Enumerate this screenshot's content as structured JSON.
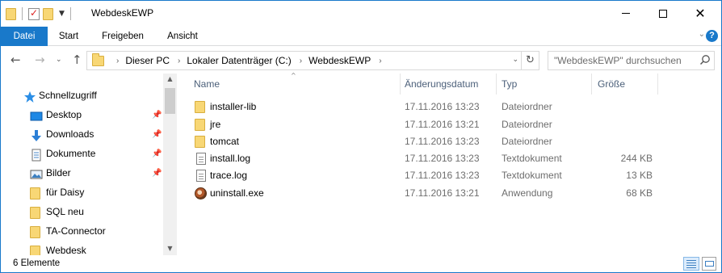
{
  "window": {
    "title": "WebdeskEWP",
    "minimize_icon": "minimize-icon",
    "maximize_icon": "maximize-icon",
    "close_icon": "close-icon"
  },
  "ribbon": {
    "tabs": [
      "Datei",
      "Start",
      "Freigeben",
      "Ansicht"
    ],
    "accent_color": "#1979ca"
  },
  "address": {
    "breadcrumbs": [
      "Dieser PC",
      "Lokaler Datenträger (C:)",
      "WebdeskEWP"
    ]
  },
  "search": {
    "placeholder": "\"WebdeskEWP\" durchsuchen"
  },
  "navpane": {
    "quick_access": "Schnellzugriff",
    "items": [
      {
        "label": "Desktop",
        "icon": "desktop-icon",
        "pinned": true
      },
      {
        "label": "Downloads",
        "icon": "download-icon",
        "pinned": true
      },
      {
        "label": "Dokumente",
        "icon": "documents-icon",
        "pinned": true
      },
      {
        "label": "Bilder",
        "icon": "pictures-icon",
        "pinned": true
      },
      {
        "label": "für Daisy",
        "icon": "folder-icon",
        "pinned": false
      },
      {
        "label": "SQL neu",
        "icon": "folder-icon",
        "pinned": false
      },
      {
        "label": "TA-Connector",
        "icon": "folder-icon",
        "pinned": false
      },
      {
        "label": "Webdesk",
        "icon": "folder-icon",
        "pinned": false
      }
    ]
  },
  "filelist": {
    "columns": {
      "name": "Name",
      "date": "Änderungsdatum",
      "type": "Typ",
      "size": "Größe"
    },
    "rows": [
      {
        "name": "installer-lib",
        "date": "17.11.2016 13:23",
        "type": "Dateiordner",
        "size": "",
        "icon": "folder-icon"
      },
      {
        "name": "jre",
        "date": "17.11.2016 13:21",
        "type": "Dateiordner",
        "size": "",
        "icon": "folder-icon"
      },
      {
        "name": "tomcat",
        "date": "17.11.2016 13:23",
        "type": "Dateiordner",
        "size": "",
        "icon": "folder-icon"
      },
      {
        "name": "install.log",
        "date": "17.11.2016 13:23",
        "type": "Textdokument",
        "size": "244 KB",
        "icon": "text-document-icon"
      },
      {
        "name": "trace.log",
        "date": "17.11.2016 13:23",
        "type": "Textdokument",
        "size": "13 KB",
        "icon": "text-document-icon"
      },
      {
        "name": "uninstall.exe",
        "date": "17.11.2016 13:21",
        "type": "Anwendung",
        "size": "68 KB",
        "icon": "application-icon"
      }
    ]
  },
  "status": {
    "item_count": "6 Elemente"
  }
}
